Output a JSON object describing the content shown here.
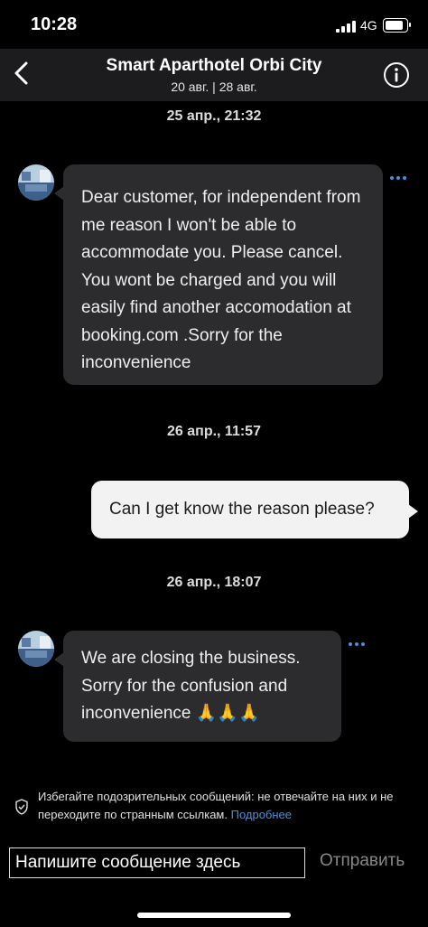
{
  "status_bar": {
    "time": "10:28",
    "network": "4G",
    "battery_level": 0.9,
    "signal_bars": 4
  },
  "header": {
    "title": "Smart Aparthotel Orbi City",
    "subtitle": "20 авг. | 28 авг.",
    "back_icon": "chevron-left-icon",
    "info_icon": "info-circle-icon"
  },
  "messages": [
    {
      "date": "25 апр., 21:32",
      "sender": "hotel",
      "text": "Dear customer, for independent from me reason I won't be able to accommodate you. Please cancel. You wont be charged and you will easily find another accomodation at booking.com .Sorry for the inconvenience"
    },
    {
      "date": "26 апр., 11:57",
      "sender": "me",
      "text": "Can I get know the reason please?"
    },
    {
      "date": "26 апр., 18:07",
      "sender": "hotel",
      "text": "We are closing the business. Sorry for the confusion and inconvenience 🙏🙏🙏"
    }
  ],
  "warning": {
    "text": "Избегайте подозрительных сообщений: не отвечайте на них и не переходите по странным ссылкам.",
    "link": "Подробнее"
  },
  "composer": {
    "placeholder": "Напишите сообщение здесь",
    "send_label": "Отправить"
  },
  "colors": {
    "background": "#000000",
    "header_bg": "#1c1c1e",
    "incoming_bubble": "#2c2c2e",
    "outgoing_bubble": "#f2f2f2",
    "link": "#4a90e2"
  }
}
